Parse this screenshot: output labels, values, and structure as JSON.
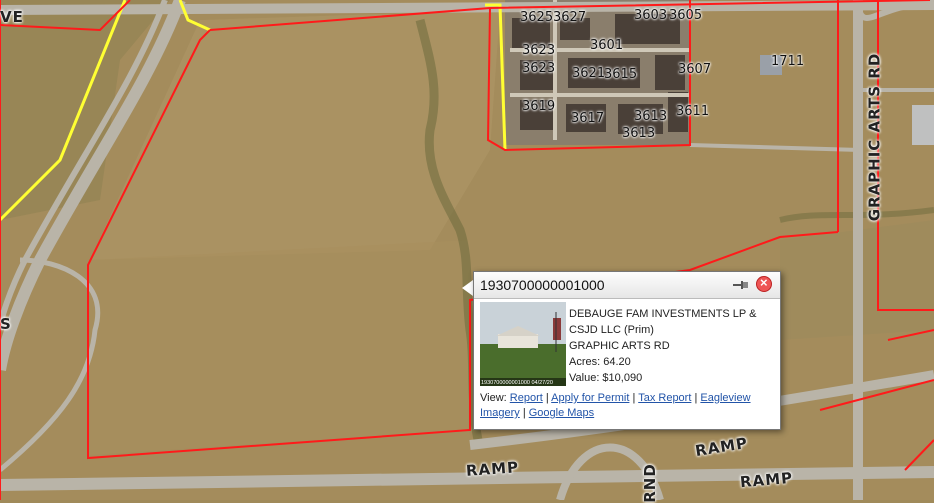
{
  "map": {
    "parcel_numbers": [
      "3625",
      "3627",
      "3603",
      "3605",
      "3623",
      "3601",
      "3623",
      "3621",
      "3615",
      "3607",
      "1711",
      "3619",
      "3617",
      "3613",
      "3613",
      "3611"
    ],
    "road_labels": {
      "graphic_arts": "GRAPHIC ARTS RD",
      "ramp1": "RAMP",
      "ramp2": "RAMP",
      "ramp3": "RAMP",
      "rnd": "RND",
      "ve": "VE",
      "edge_s": "S"
    },
    "colors": {
      "parcel_boundary": "#ff1a1a",
      "city_limit": "#ffff33"
    }
  },
  "popup": {
    "parcel_id": "1930700000001000",
    "owner_line1": "DEBAUGE FAM INVESTMENTS LP &",
    "owner_line2": "CSJD LLC (Prim)",
    "address": "GRAPHIC ARTS RD",
    "acres": "Acres: 64.20",
    "value": "Value: $10,090",
    "photo_caption": "1930700000001000 04/27/20",
    "links": {
      "prefix": "View:",
      "report": "Report",
      "permit": "Apply for Permit",
      "tax": "Tax Report",
      "eagleview": "Eagleview Imagery",
      "google": "Google Maps",
      "sep": "|"
    }
  }
}
